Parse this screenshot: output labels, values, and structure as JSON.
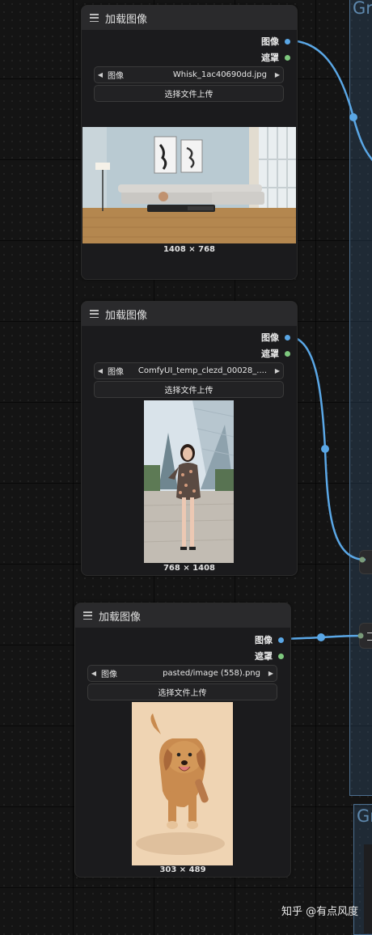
{
  "canvas": {
    "groups": [
      {
        "title": "Gr"
      },
      {
        "title": "Gr"
      }
    ],
    "link_color": "#5aa7e6"
  },
  "nodes": [
    {
      "title": "加载图像",
      "outputs": [
        {
          "label": "图像",
          "color": "#5aa7e6"
        },
        {
          "label": "遮罩",
          "color": "#7ec87e"
        }
      ],
      "image_widget": {
        "label": "图像",
        "value": "Whisk_1ac40690dd.jpg"
      },
      "upload_label": "选择文件上传",
      "preview_subject": "living-room-photo",
      "dimensions": "1408 × 768"
    },
    {
      "title": "加载图像",
      "outputs": [
        {
          "label": "图像",
          "color": "#5aa7e6"
        },
        {
          "label": "遮罩",
          "color": "#7ec87e"
        }
      ],
      "image_widget": {
        "label": "图像",
        "value": "ComfyUI_temp_clezd_00028_...."
      },
      "upload_label": "选择文件上传",
      "preview_subject": "woman-fashion-photo",
      "dimensions": "768 × 1408"
    },
    {
      "title": "加载图像",
      "outputs": [
        {
          "label": "图像",
          "color": "#5aa7e6"
        },
        {
          "label": "遮罩",
          "color": "#7ec87e"
        }
      ],
      "image_widget": {
        "label": "图像",
        "value": "pasted/image (558).png"
      },
      "upload_label": "选择文件上传",
      "preview_subject": "puppy-photo",
      "dimensions": "303 × 489"
    }
  ],
  "watermark": "知乎 @有点风度"
}
